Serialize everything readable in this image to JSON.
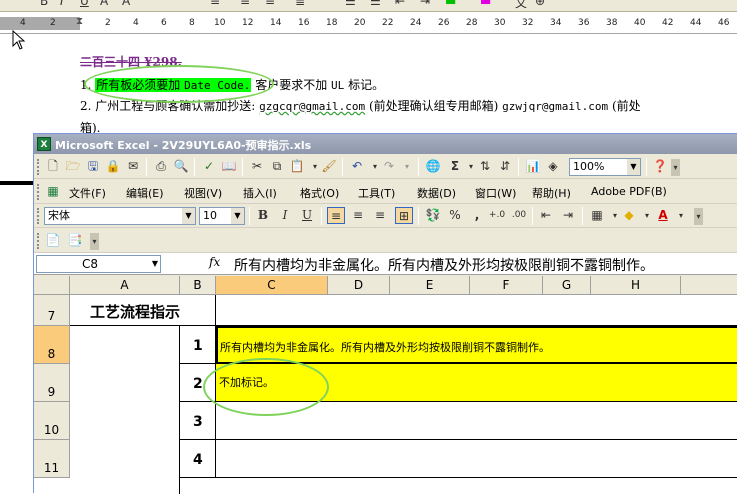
{
  "word": {
    "ruler_numbers": [
      "4",
      "2",
      "2",
      "4",
      "6",
      "8",
      "10",
      "12",
      "14",
      "16",
      "18",
      "20",
      "22",
      "24",
      "26",
      "28",
      "30",
      "32",
      "34",
      "36",
      "38",
      "40",
      "42",
      "44",
      "46"
    ],
    "heading_partial": "二百三十四 ¥298.",
    "line1_num": "1.",
    "line1_highlight_cn": "所有板必须要加",
    "line1_highlight_code": "Date Code.",
    "line1_rest_a": "客户要求不加",
    "line1_rest_ul": "UL",
    "line1_rest_b": "标记。",
    "line2_num": "2.",
    "line2_text_a": "广州工程与顾客确认需加抄送:",
    "line2_email1": "gzgcqr@gmail.com",
    "line2_text_b": "(前处理确认组专用邮箱)",
    "line2_email2": "gzwjqr@gmail.com",
    "line2_text_c": "(前处",
    "line3_text": "箱)."
  },
  "excel": {
    "title": "Microsoft Excel - 2V29UYL6A0-预审指示.xls",
    "menu": [
      {
        "label": "文件(F)"
      },
      {
        "label": "编辑(E)"
      },
      {
        "label": "视图(V)"
      },
      {
        "label": "插入(I)"
      },
      {
        "label": "格式(O)"
      },
      {
        "label": "工具(T)"
      },
      {
        "label": "数据(D)"
      },
      {
        "label": "窗口(W)"
      },
      {
        "label": "帮助(H)"
      },
      {
        "label": "Adobe PDF(B)"
      }
    ],
    "zoom": "100%",
    "font_name": "宋体",
    "font_size": "10",
    "name_box": "C8",
    "fx_label": "fx",
    "formula_text": "所有内槽均为非金属化。所有内槽及外形均按极限削铜不露铜制作。",
    "columns": [
      {
        "label": "A"
      },
      {
        "label": "B"
      },
      {
        "label": "C"
      },
      {
        "label": "D"
      },
      {
        "label": "E"
      },
      {
        "label": "F"
      },
      {
        "label": "G"
      },
      {
        "label": "H"
      }
    ],
    "rows": [
      {
        "num": "7",
        "a": "工艺流程指示",
        "b": "",
        "c": ""
      },
      {
        "num": "8",
        "a": "",
        "b": "1",
        "c": "所有内槽均为非金属化。所有内槽及外形均按极限削铜不露铜制作。"
      },
      {
        "num": "9",
        "a": "",
        "b": "2",
        "c": "不加标记。"
      },
      {
        "num": "10",
        "a": "",
        "b": "3",
        "c": ""
      },
      {
        "num": "11",
        "a": "",
        "b": "4",
        "c": ""
      }
    ],
    "colors": {
      "highlight_yellow": "#ffff00",
      "word_green_highlight": "#00ff00",
      "annotation_green": "#7fd35a",
      "selected_header": "#f9cb7a"
    }
  }
}
